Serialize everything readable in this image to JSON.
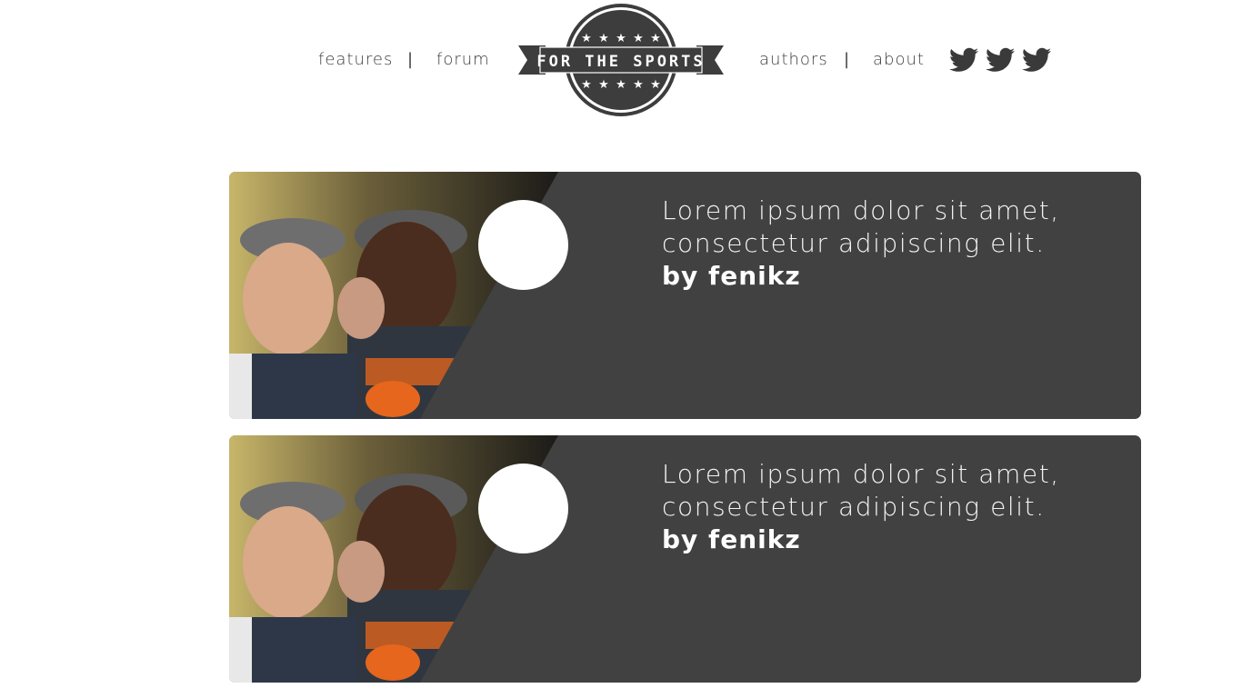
{
  "nav": {
    "left": [
      {
        "label": "features"
      },
      {
        "label": "forum"
      }
    ],
    "right": [
      {
        "label": "authors"
      },
      {
        "label": "about"
      }
    ],
    "separator": "|"
  },
  "logo": {
    "text": "FOR THE SPORTS"
  },
  "social": [
    {
      "icon": "twitter-icon"
    },
    {
      "icon": "twitter-icon"
    },
    {
      "icon": "twitter-icon"
    }
  ],
  "cards": [
    {
      "line1": "Lorem ipsum dolor sit amet,",
      "line2": "consectetur adipiscing elit.",
      "author": "by fenikz"
    },
    {
      "line1": "Lorem ipsum dolor sit amet,",
      "line2": "consectetur adipiscing elit.",
      "author": "by fenikz"
    }
  ],
  "colors": {
    "card_bg": "#414141",
    "nav_text": "#3c3c3c",
    "logo_dark": "#3d3d3d"
  }
}
